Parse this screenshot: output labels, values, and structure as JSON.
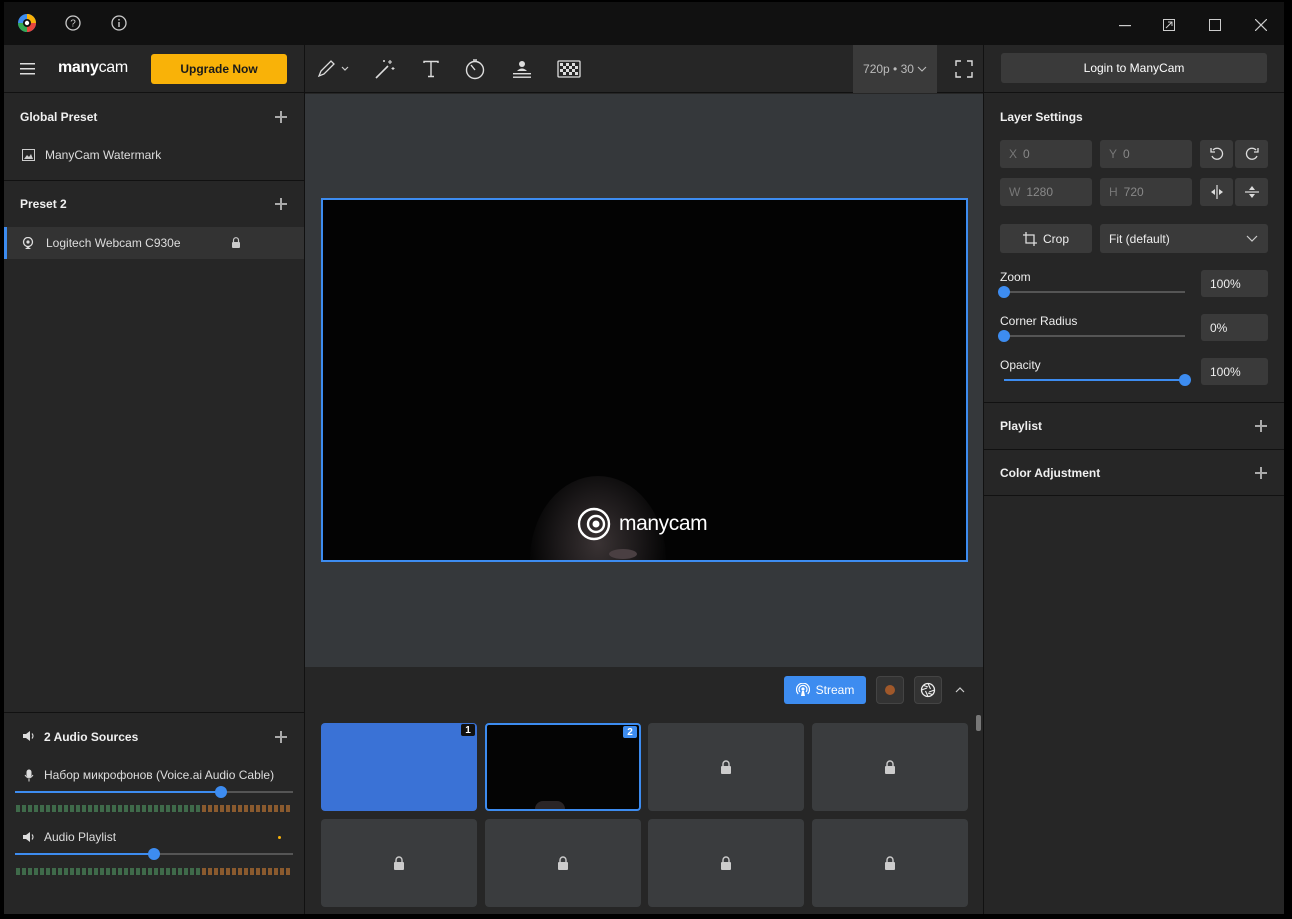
{
  "titlebar": {
    "app_icon": "manycam-logo-icon",
    "help_icon": "help-icon",
    "info_icon": "info-icon"
  },
  "header": {
    "brand": "manycam",
    "upgrade_label": "Upgrade Now",
    "resolution": "720p • 30",
    "login_label": "Login to ManyCam"
  },
  "left": {
    "global_preset_title": "Global Preset",
    "global_items": [
      {
        "label": "ManyCam Watermark",
        "icon": "image-icon"
      }
    ],
    "preset_title": "Preset 2",
    "preset_items": [
      {
        "label": "Logitech Webcam C930e",
        "icon": "webcam-icon",
        "locked": true
      }
    ],
    "audio_title": "2 Audio Sources",
    "audio": [
      {
        "label": "Набор микрофонов (Voice.ai Audio Cable)",
        "icon": "microphone-icon",
        "level": 0.72
      },
      {
        "label": "Audio Playlist",
        "icon": "speaker-icon",
        "level": 0.49
      }
    ]
  },
  "preview": {
    "watermark_text": "manycam"
  },
  "controls": {
    "stream_label": "Stream"
  },
  "presets_grid": {
    "cells": [
      {
        "num": "1",
        "state": "active-blue"
      },
      {
        "num": "2",
        "state": "selected"
      },
      {
        "num": "",
        "state": "locked"
      },
      {
        "num": "",
        "state": "locked"
      },
      {
        "num": "",
        "state": "locked"
      },
      {
        "num": "",
        "state": "locked"
      },
      {
        "num": "",
        "state": "locked"
      },
      {
        "num": "",
        "state": "locked"
      }
    ]
  },
  "layer_settings": {
    "title": "Layer Settings",
    "x_label": "X",
    "x_value": "0",
    "y_label": "Y",
    "y_value": "0",
    "w_label": "W",
    "w_value": "1280",
    "h_label": "H",
    "h_value": "720",
    "crop_label": "Crop",
    "fit_value": "Fit (default)",
    "zoom_label": "Zoom",
    "zoom_value": "100%",
    "zoom_level": 0.0,
    "corner_label": "Corner Radius",
    "corner_value": "0%",
    "corner_level": 0.0,
    "opacity_label": "Opacity",
    "opacity_value": "100%",
    "opacity_level": 1.0
  },
  "right_sections": {
    "playlist": "Playlist",
    "color": "Color Adjustment"
  },
  "colors": {
    "accent": "#3d8cf0",
    "upgrade": "#f9b208",
    "bg": "#262626"
  }
}
